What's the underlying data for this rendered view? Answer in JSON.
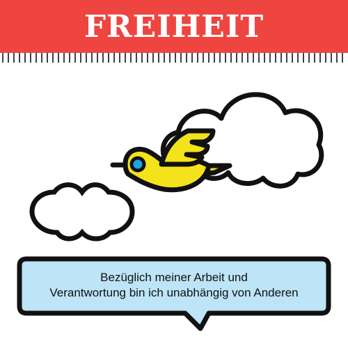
{
  "header": {
    "title": "FREIHEIT",
    "background_color": "#ee4540",
    "text_color": "#ffffff"
  },
  "illustration": {
    "bird_color": "#f4e21b",
    "bird_eye_color": "#1aa6e0",
    "outline_color": "#111111",
    "cloud_fill": "#ffffff"
  },
  "speech_bubble": {
    "line1": "Bezüglich meiner Arbeit und",
    "line2": "Verantwortung bin ich unabhängig von Anderen",
    "fill_color": "#bde4f7"
  }
}
